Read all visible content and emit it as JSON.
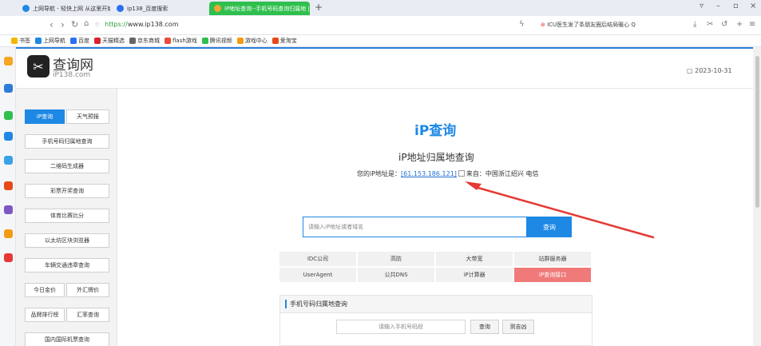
{
  "browser": {
    "tabs": [
      {
        "label": "上网导航 - 轻快上网 从这里开始",
        "color": "#1e88e5",
        "active": false
      },
      {
        "label": "ip138_百度搜索",
        "color": "#2b6ff3",
        "active": false
      },
      {
        "label": "iP地址查询--手机号码查询归属地 | i",
        "color": "#f2a33a",
        "active": true
      }
    ],
    "tab_close": "×",
    "new_tab": "+",
    "url_scheme": "https://",
    "url_host": "www.ip138.com",
    "right_news": "ICU医生发了条朋友圈后结局暖心 Q",
    "window_controls": [
      "▿",
      "–",
      "▫",
      "×"
    ]
  },
  "bookmarks": [
    {
      "label": "书签",
      "color": "#f5b400"
    },
    {
      "label": "上网导航",
      "color": "#1e88e5"
    },
    {
      "label": "百度",
      "color": "#2b6ff3"
    },
    {
      "label": "天猫精选",
      "color": "#d9232d"
    },
    {
      "label": "京东商城",
      "color": "#666666"
    },
    {
      "label": "flash游戏",
      "color": "#e94b3c"
    },
    {
      "label": "腾讯视频",
      "color": "#2fbf4d"
    },
    {
      "label": "游戏中心",
      "color": "#f39c12"
    },
    {
      "label": "爱淘宝",
      "color": "#e64a19"
    }
  ],
  "side_icons": [
    "#f5a623",
    "#2f7cd8",
    "#2fbf4d",
    "#1e88e5",
    "#3aa0e8",
    "#e64a19",
    "#7e57c2",
    "#f39c12",
    "#e53935"
  ],
  "site": {
    "logo_title": "查询网",
    "logo_sub": "iP138.com",
    "date": "2023-10-31"
  },
  "leftnav": {
    "ip_tab": "iP查询",
    "weather_tab": "天气预报",
    "items": [
      "手机号码归属地查询",
      "二维码生成器",
      "彩票开奖查询",
      "体育比赛比分",
      "以太坊区块浏览器",
      "车辆交通违章查询"
    ],
    "pair1": [
      "今日金价",
      "外汇牌价"
    ],
    "pair2": [
      "品牌排行榜",
      "汇率查询"
    ],
    "last": "国内国际机票查询"
  },
  "main": {
    "title": "iP查询",
    "subtitle": "iP地址归属地查询",
    "ip_prefix": "您的iP地址是：",
    "ip": "[61.153.186.121]",
    "ip_suffix": "来自：中国浙江绍兴 电信",
    "search_placeholder": "请输入iP地址或者域名",
    "search_button": "查询",
    "grid": [
      [
        "IDC公司",
        "高防",
        "大带宽",
        "站群服务器"
      ],
      [
        "UserAgent",
        "公共DNS",
        "iP计算器",
        "iP查询接口"
      ]
    ],
    "phone_panel_title": "手机号码归属地查询",
    "phone_placeholder": "请输入手机号码段",
    "phone_query": "查询",
    "phone_luck": "测吉凶"
  }
}
